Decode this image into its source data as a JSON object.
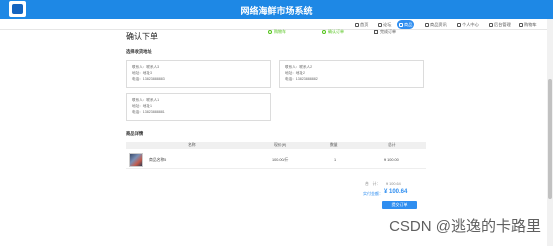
{
  "header": {
    "site_title": "网络海鲜市场系统"
  },
  "nav": {
    "items": [
      {
        "label": "首页",
        "active": false
      },
      {
        "label": "论坛",
        "active": false
      },
      {
        "label": "商品",
        "active": true
      },
      {
        "label": "商品资讯",
        "active": false
      },
      {
        "label": "个人中心",
        "active": false
      },
      {
        "label": "后台管理",
        "active": false
      },
      {
        "label": "购物车",
        "active": false
      }
    ]
  },
  "steps": [
    {
      "label": "购物车"
    },
    {
      "label": "确认订单"
    },
    {
      "label": "完成订单"
    }
  ],
  "page": {
    "title": "确认下单"
  },
  "address_section": {
    "title": "选择收货地址",
    "cards": [
      {
        "lines": [
          "联系人：联系人3",
          "地址：地址3",
          "电话：13823888883"
        ]
      },
      {
        "lines": [
          "联系人：联系人2",
          "地址：地址2",
          "电话：13823888882"
        ]
      },
      {
        "lines": [
          "联系人：联系人1",
          "地址：地址1",
          "电话：13823888881"
        ]
      }
    ]
  },
  "products_section": {
    "title": "商品详情",
    "columns": [
      "名称",
      "现价(¥)",
      "数量",
      "总计"
    ],
    "rows": [
      {
        "name": "商品名称5",
        "price": "100.00/斤",
        "qty": "1",
        "total": "¥ 100.00"
      }
    ]
  },
  "summary": {
    "subtotal_label": "合　计：",
    "subtotal_value": "¥ 100.64",
    "grand_label": "实付金额：",
    "grand_value": "¥ 100.64",
    "submit_label": "提交订单"
  },
  "watermark": "CSDN @逃逸的卡路里",
  "colors": {
    "primary": "#1e88e5",
    "accent": "#2f8ef0",
    "step_done": "#52c41a"
  }
}
